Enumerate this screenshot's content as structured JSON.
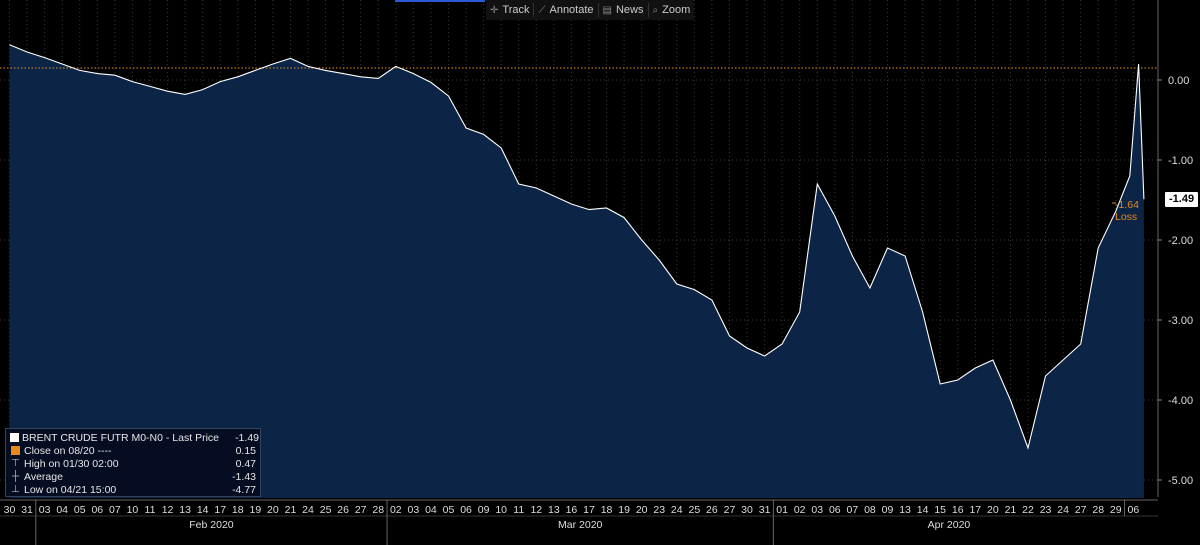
{
  "toolbar": {
    "track": "Track",
    "annotate": "Annotate",
    "news": "News",
    "zoom": "Zoom"
  },
  "colors": {
    "background": "#000000",
    "area_fill": "#0c2446",
    "line": "#ffffff",
    "reference_line": "#e89322",
    "grid": "#3a3a3a",
    "accent": "#e8891a"
  },
  "legend": {
    "series": {
      "label": "BRENT CRUDE FUTR M0-N0 - Last Price",
      "value": "-1.49",
      "marker_color": "#ffffff"
    },
    "close": {
      "label": "Close on 08/20 ----",
      "value": "0.15",
      "marker_color": "#e8891a"
    },
    "high": {
      "label": "High on 01/30 02:00",
      "value": "0.47"
    },
    "average": {
      "label": "Average",
      "value": "-1.43"
    },
    "low": {
      "label": "Low on 04/21 15:00",
      "value": "-4.77"
    }
  },
  "price_tag": "-1.49",
  "annotation": {
    "value": "-1.64",
    "label": "Loss"
  },
  "chart_data": {
    "type": "area",
    "series": [
      {
        "name": "BRENT CRUDE FUTR M0-N0 - Last Price"
      }
    ],
    "reference_line": {
      "value": 0.15
    },
    "ylim": [
      -5.2,
      0.55
    ],
    "yticks": [
      "0.00",
      "-1.00",
      "-2.00",
      "-3.00",
      "-4.00",
      "-5.00"
    ],
    "ytick_values": [
      0,
      -1,
      -2,
      -3,
      -4,
      -5
    ],
    "day_labels": [
      "30",
      "31",
      "03",
      "04",
      "05",
      "06",
      "07",
      "10",
      "11",
      "12",
      "13",
      "14",
      "17",
      "18",
      "19",
      "20",
      "21",
      "24",
      "25",
      "26",
      "27",
      "28",
      "02",
      "03",
      "04",
      "05",
      "06",
      "09",
      "10",
      "11",
      "12",
      "13",
      "16",
      "17",
      "18",
      "19",
      "20",
      "23",
      "24",
      "25",
      "26",
      "27",
      "30",
      "31",
      "01",
      "02",
      "03",
      "06",
      "07",
      "08",
      "09",
      "13",
      "14",
      "15",
      "16",
      "17",
      "20",
      "21",
      "22",
      "23",
      "24",
      "27",
      "28",
      "29",
      "06"
    ],
    "month_labels": [
      "Feb 2020",
      "Mar 2020",
      "Apr 2020"
    ],
    "month_start_day_index": [
      2,
      22,
      44
    ],
    "points": [
      [
        0,
        0.44
      ],
      [
        1,
        0.35
      ],
      [
        2,
        0.28
      ],
      [
        3,
        0.2
      ],
      [
        4,
        0.12
      ],
      [
        5,
        0.08
      ],
      [
        6,
        0.06
      ],
      [
        7,
        -0.02
      ],
      [
        8,
        -0.08
      ],
      [
        9,
        -0.14
      ],
      [
        10,
        -0.18
      ],
      [
        11,
        -0.12
      ],
      [
        12,
        -0.02
      ],
      [
        13,
        0.04
      ],
      [
        14,
        0.12
      ],
      [
        15,
        0.2
      ],
      [
        16,
        0.27
      ],
      [
        17,
        0.17
      ],
      [
        18,
        0.12
      ],
      [
        19,
        0.08
      ],
      [
        20,
        0.04
      ],
      [
        21,
        0.02
      ],
      [
        22,
        0.17
      ],
      [
        23,
        0.08
      ],
      [
        24,
        -0.03
      ],
      [
        25,
        -0.2
      ],
      [
        26,
        -0.6
      ],
      [
        27,
        -0.68
      ],
      [
        28,
        -0.85
      ],
      [
        29,
        -1.3
      ],
      [
        30,
        -1.35
      ],
      [
        31,
        -1.45
      ],
      [
        32,
        -1.55
      ],
      [
        33,
        -1.62
      ],
      [
        34,
        -1.6
      ],
      [
        35,
        -1.72
      ],
      [
        36,
        -2.0
      ],
      [
        37,
        -2.25
      ],
      [
        38,
        -2.55
      ],
      [
        39,
        -2.62
      ],
      [
        40,
        -2.75
      ],
      [
        41,
        -3.2
      ],
      [
        42,
        -3.35
      ],
      [
        43,
        -3.45
      ],
      [
        44,
        -3.3
      ],
      [
        45,
        -2.9
      ],
      [
        46,
        -1.3
      ],
      [
        47,
        -1.7
      ],
      [
        48,
        -2.2
      ],
      [
        49,
        -2.6
      ],
      [
        50,
        -2.1
      ],
      [
        51,
        -2.2
      ],
      [
        52,
        -2.9
      ],
      [
        53,
        -3.8
      ],
      [
        54,
        -3.75
      ],
      [
        55,
        -3.6
      ],
      [
        56,
        -3.5
      ],
      [
        57,
        -4.0
      ],
      [
        58,
        -4.6
      ],
      [
        59,
        -3.7
      ],
      [
        60,
        -3.5
      ],
      [
        61,
        -3.3
      ],
      [
        62,
        -2.1
      ],
      [
        63,
        -1.64
      ],
      [
        63.8,
        -1.2
      ],
      [
        64.3,
        0.2
      ],
      [
        64.6,
        -1.49
      ]
    ]
  }
}
